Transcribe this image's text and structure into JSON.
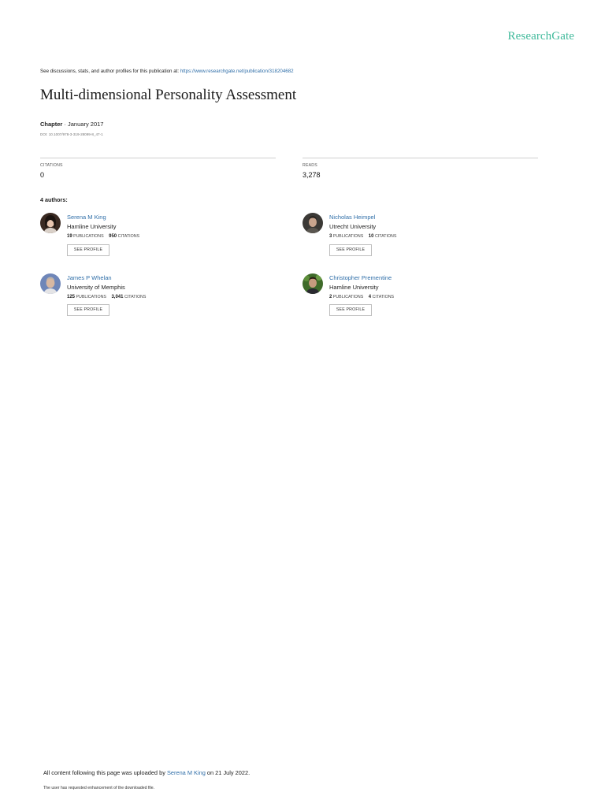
{
  "brand": {
    "name": "ResearchGate",
    "color": "#40ba9b"
  },
  "header": {
    "discussions_prefix": "See discussions, stats, and author profiles for this publication at: ",
    "publication_url": "https://www.researchgate.net/publication/318204682"
  },
  "publication": {
    "title": "Multi-dimensional Personality Assessment",
    "type": "Chapter",
    "separator": " · ",
    "date": "January 2017",
    "doi": "DOI: 10.1007/978-3-319-28099-8_47-1"
  },
  "stats": {
    "citations_label": "CITATIONS",
    "citations_value": "0",
    "reads_label": "READS",
    "reads_value": "3,278"
  },
  "authors_heading": "4 authors:",
  "authors": [
    {
      "name": "Serena M King",
      "institution": "Hamline University",
      "publications": "19",
      "publications_label": "PUBLICATIONS",
      "citations": "950",
      "citations_label": "CITATIONS",
      "button_label": "SEE PROFILE"
    },
    {
      "name": "Nicholas Heimpel",
      "institution": "Utrecht University",
      "publications": "3",
      "publications_label": "PUBLICATIONS",
      "citations": "10",
      "citations_label": "CITATIONS",
      "button_label": "SEE PROFILE"
    },
    {
      "name": "James P Whelan",
      "institution": "University of Memphis",
      "publications": "125",
      "publications_label": "PUBLICATIONS",
      "citations": "3,041",
      "citations_label": "CITATIONS",
      "button_label": "SEE PROFILE"
    },
    {
      "name": "Christopher Prementine",
      "institution": "Hamline University",
      "publications": "2",
      "publications_label": "PUBLICATIONS",
      "citations": "4",
      "citations_label": "CITATIONS",
      "button_label": "SEE PROFILE"
    }
  ],
  "footer": {
    "upload_prefix": "All content following this page was uploaded by ",
    "uploader": "Serena M King",
    "upload_suffix": " on 21 July 2022.",
    "note": "The user has requested enhancement of the downloaded file."
  },
  "colors": {
    "link": "#2f6ea8",
    "text": "#222222",
    "rule": "#cfcfcf"
  }
}
